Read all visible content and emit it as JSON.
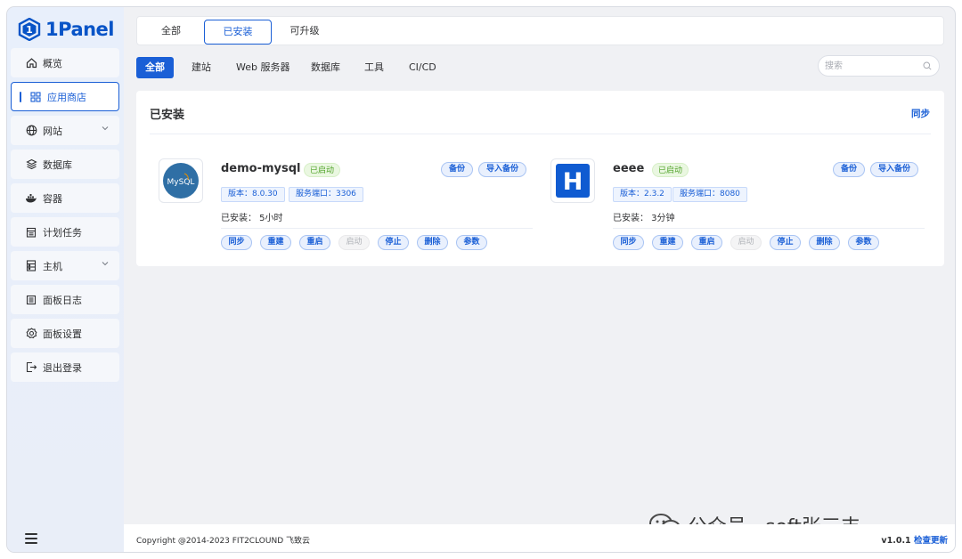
{
  "brand": {
    "name": "1Panel",
    "color": "#0854c7",
    "accent": "#1a5fd6"
  },
  "sidebar": {
    "items": [
      {
        "label": "概览",
        "icon": "home-icon"
      },
      {
        "label": "应用商店",
        "icon": "grid-icon",
        "active": true
      },
      {
        "label": "网站",
        "icon": "globe-icon",
        "expandable": true
      },
      {
        "label": "数据库",
        "icon": "database-icon"
      },
      {
        "label": "容器",
        "icon": "docker-icon"
      },
      {
        "label": "计划任务",
        "icon": "calendar-icon"
      },
      {
        "label": "主机",
        "icon": "server-icon",
        "expandable": true
      },
      {
        "label": "面板日志",
        "icon": "log-icon"
      },
      {
        "label": "面板设置",
        "icon": "gear-icon"
      },
      {
        "label": "退出登录",
        "icon": "logout-icon"
      }
    ]
  },
  "top_tabs": [
    {
      "label": "全部"
    },
    {
      "label": "已安装",
      "active": true
    },
    {
      "label": "可升级"
    }
  ],
  "filters": [
    {
      "label": "全部",
      "active": true
    },
    {
      "label": "建站"
    },
    {
      "label": "Web 服务器"
    },
    {
      "label": "数据库"
    },
    {
      "label": "工具"
    },
    {
      "label": "CI/CD"
    }
  ],
  "search": {
    "placeholder": "搜索"
  },
  "content": {
    "title": "已安装",
    "sync_label": "同步"
  },
  "apps": [
    {
      "name": "demo-mysql",
      "status": "已启动",
      "logo_text": "MySQL",
      "backup_label": "备份",
      "import_backup_label": "导入备份",
      "version_tag": "版本：8.0.30",
      "port_tag": "服务端口：3306",
      "installed": "已安装：  5小时",
      "actions": [
        "同步",
        "重建",
        "重启",
        "启动",
        "停止",
        "删除",
        "参数"
      ]
    },
    {
      "name": "eeee",
      "status": "已启动",
      "logo_text": "H",
      "backup_label": "备份",
      "import_backup_label": "导入备份",
      "version_tag": "版本：2.3.2",
      "port_tag": "服务端口：8080",
      "installed": "已安装：  3分钟",
      "actions": [
        "同步",
        "重建",
        "重启",
        "启动",
        "停止",
        "删除",
        "参数"
      ]
    }
  ],
  "footer": {
    "copyright": "Copyright @2014-2023 FIT2CLOUND 飞致云",
    "version": "v1.0.1",
    "check_update": "检查更新"
  },
  "watermark": {
    "text": "公众号 · soft张三丰",
    "icon": "wechat-icon"
  }
}
